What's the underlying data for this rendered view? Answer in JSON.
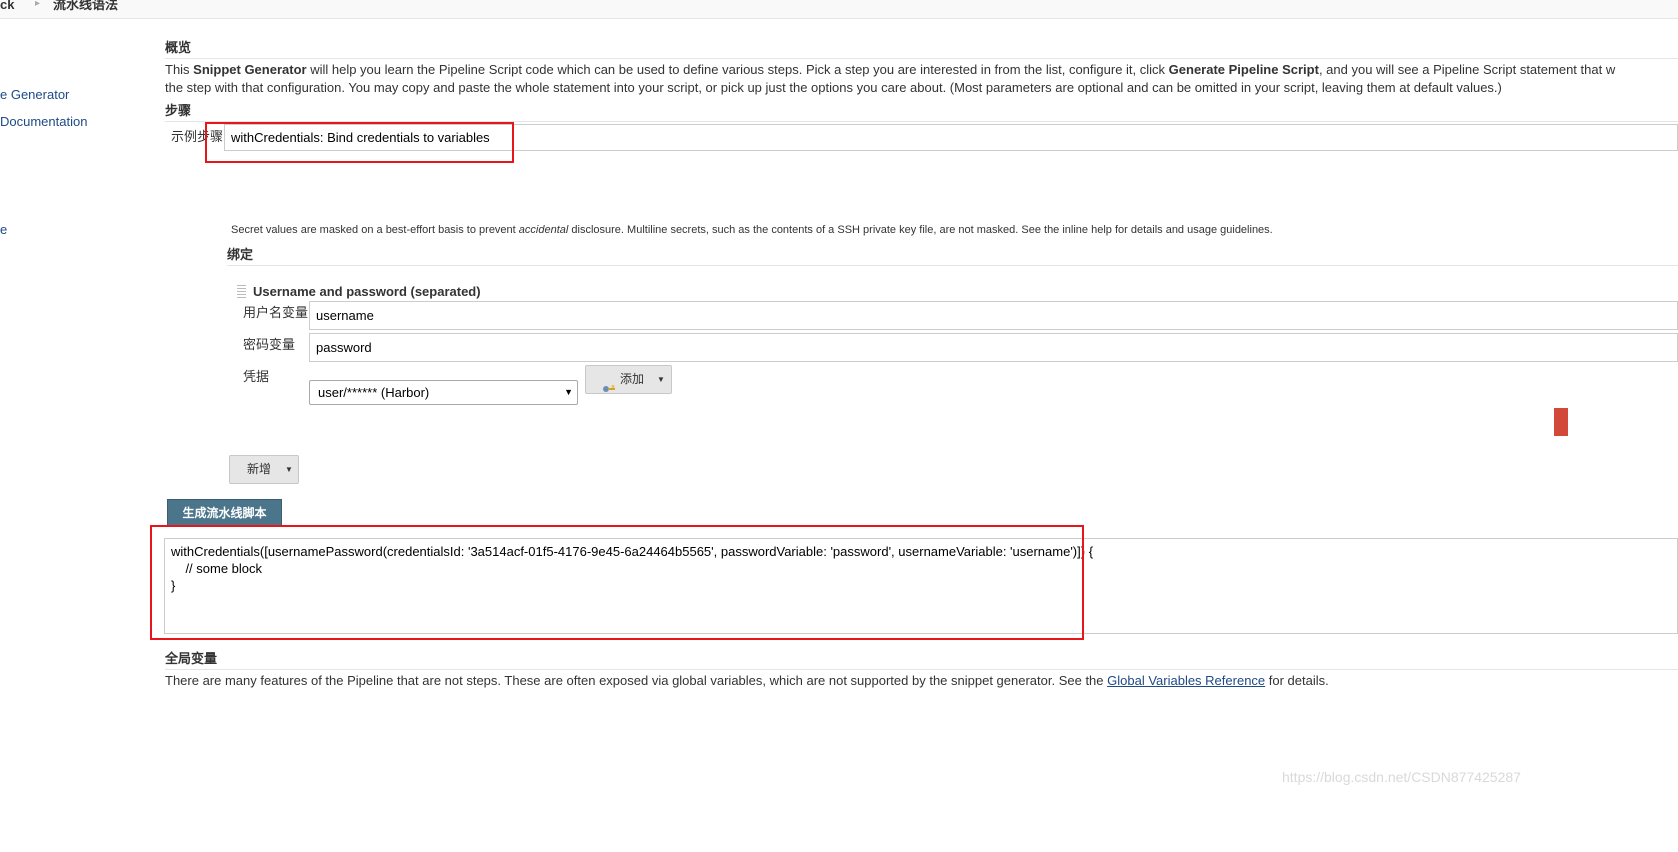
{
  "breadcrumb": {
    "item1": "ck",
    "separator": "▸",
    "item2": "流水线语法"
  },
  "sidebar": {
    "items": [
      {
        "label": "e Generator"
      },
      {
        "label": "Documentation"
      },
      {
        "label": "e"
      }
    ]
  },
  "overview": {
    "heading": "概览",
    "text_before_bold1": "This ",
    "bold1": "Snippet Generator",
    "text_mid": " will help you learn the Pipeline Script code which can be used to define various steps. Pick a step you are interested in from the list, configure it, click ",
    "bold2": "Generate Pipeline Script",
    "text_after": ", and you will see a Pipeline Script statement that w",
    "line2": "the step with that configuration. You may copy and paste the whole statement into your script, or pick up just the options you care about. (Most parameters are optional and can be omitted in your script, leaving them at default values.)"
  },
  "steps": {
    "heading": "步骤",
    "sample_step_label": "示例步骤",
    "sample_step_value": "withCredentials: Bind credentials to variables"
  },
  "secret_note": {
    "before": "Secret values are masked on a best-effort basis to prevent ",
    "italic": "accidental",
    "after": " disclosure. Multiline secrets, such as the contents of a SSH private key file, are not masked. See the inline help for details and usage guidelines."
  },
  "bindings": {
    "heading": "绑定",
    "binding_title": "Username and password (separated)",
    "username_label": "用户名变量",
    "username_value": "username",
    "password_label": "密码变量",
    "password_value": "password",
    "credentials_label": "凭据",
    "credentials_selected": "user/****** (Harbor)",
    "add_button": "添加",
    "new_button": "新增"
  },
  "generate": {
    "button_label": "生成流水线脚本",
    "script_output": "withCredentials([usernamePassword(credentialsId: '3a514acf-01f5-4176-9e45-6a24464b5565', passwordVariable: 'password', usernameVariable: 'username')]) {\n    // some block\n}"
  },
  "global_vars": {
    "heading": "全局变量",
    "text_before": "There are many features of the Pipeline that are not steps. These are often exposed via global variables, which are not supported by the snippet generator. See the ",
    "link": "Global Variables Reference",
    "text_after": " for details."
  },
  "watermark": "https://blog.csdn.net/CSDN877425287",
  "colors": {
    "accent_button": "#4b758b",
    "highlight_red": "#e8161b",
    "link": "#204a87"
  }
}
